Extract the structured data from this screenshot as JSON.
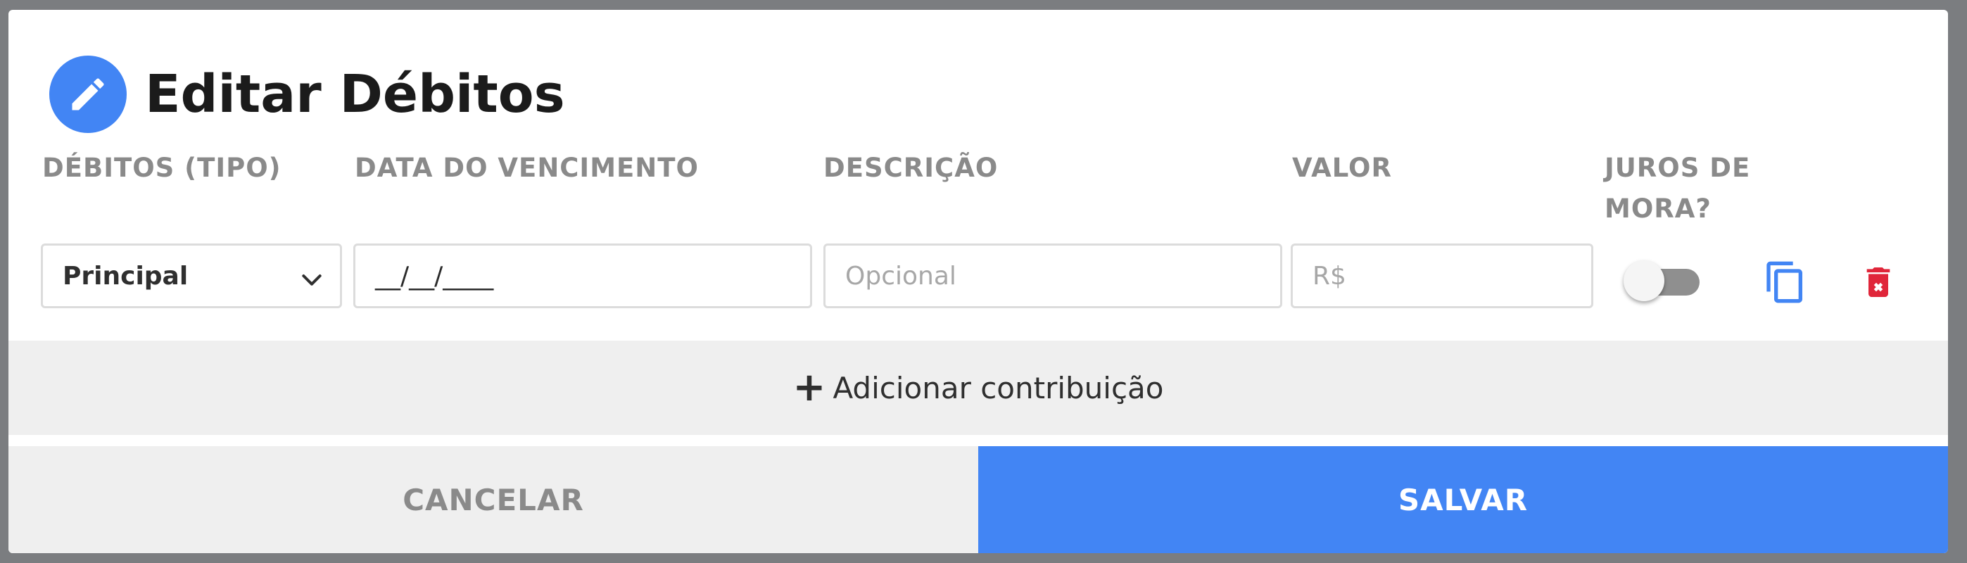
{
  "dialog": {
    "title": "Editar Débitos"
  },
  "columns": {
    "tipo": "DÉBITOS (TIPO)",
    "vencimento": "DATA DO VENCIMENTO",
    "descricao": "DESCRIÇÃO",
    "valor": "VALOR",
    "juros_line1": "JUROS DE",
    "juros_line2": "MORA?"
  },
  "row": {
    "tipo_value": "Principal",
    "vencimento_value": "__/__/____",
    "descricao_placeholder": "Opcional",
    "valor_placeholder": "R$",
    "juros_toggle": false
  },
  "actions": {
    "add_contribution": "Adicionar contribuição",
    "cancel": "CANCELAR",
    "save": "SALVAR"
  },
  "icons": {
    "edit": "pencil-icon",
    "dropdown": "chevron-down-icon",
    "duplicate": "copy-icon",
    "delete": "trash-icon",
    "add": "plus-icon"
  },
  "colors": {
    "accent": "#4285f4",
    "danger": "#e0263a",
    "muted_text": "#8a8a8a",
    "bar_bg": "#efefef"
  }
}
